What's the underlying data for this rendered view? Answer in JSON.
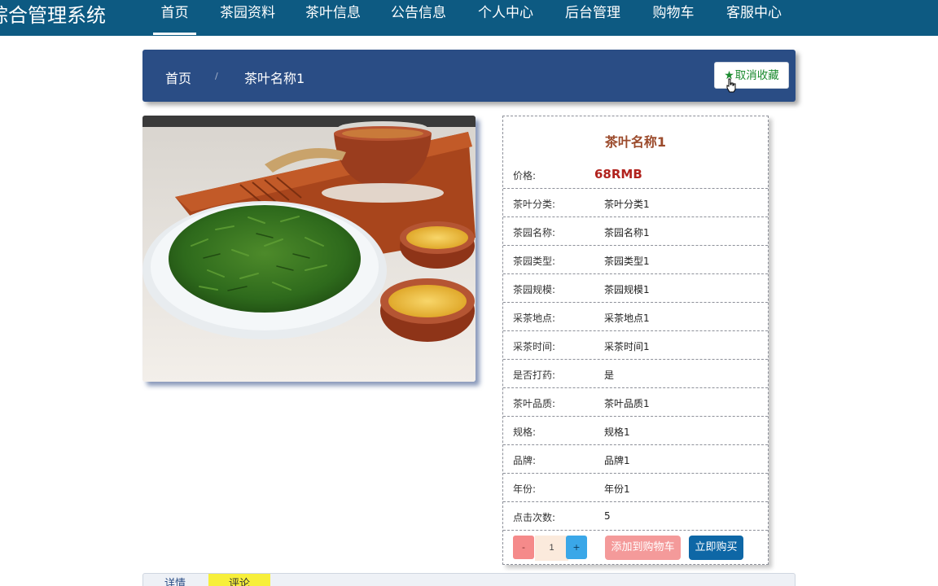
{
  "app": {
    "title": "综合管理系统"
  },
  "nav": {
    "items": [
      {
        "label": "首页"
      },
      {
        "label": "茶园资料"
      },
      {
        "label": "茶叶信息"
      },
      {
        "label": "公告信息"
      },
      {
        "label": "个人中心"
      },
      {
        "label": "后台管理"
      },
      {
        "label": "购物车"
      },
      {
        "label": "客服中心"
      }
    ],
    "active_index": 0
  },
  "breadcrumb": {
    "home": "首页",
    "separator": "/",
    "current": "茶叶名称1",
    "favorite_button": "取消收藏",
    "favorite_icon": "star-icon"
  },
  "product": {
    "image_icon": "tea-photo",
    "name": "茶叶名称1",
    "price_label": "价格:",
    "price": "68RMB",
    "fields": [
      {
        "label": "茶叶分类:",
        "value": "茶叶分类1"
      },
      {
        "label": "茶园名称:",
        "value": "茶园名称1"
      },
      {
        "label": "茶园类型:",
        "value": "茶园类型1"
      },
      {
        "label": "茶园规模:",
        "value": "茶园规模1"
      },
      {
        "label": "采茶地点:",
        "value": "采茶地点1"
      },
      {
        "label": "采茶时间:",
        "value": "采茶时间1"
      },
      {
        "label": "是否打药:",
        "value": "是"
      },
      {
        "label": "茶叶品质:",
        "value": "茶叶品质1"
      },
      {
        "label": "规格:",
        "value": "规格1"
      },
      {
        "label": "品牌:",
        "value": "品牌1"
      },
      {
        "label": "年份:",
        "value": "年份1"
      },
      {
        "label": "点击次数:",
        "value": "5"
      }
    ]
  },
  "actions": {
    "minus_label": "-",
    "quantity": "1",
    "plus_label": "+",
    "add_to_cart": "添加到购物车",
    "buy_now": "立即购买"
  },
  "tabs": {
    "detail": "详情",
    "comment": "评论"
  },
  "colors": {
    "nav_bg": "#0d5a82",
    "header_bg": "#2a4d85",
    "price": "#b1221d",
    "title": "#9b4a2b",
    "favorite": "#1a8a2e",
    "cart_button": "#f49a9a",
    "buy_button": "#0e67a6",
    "comment_tab": "#f7ef3a"
  }
}
